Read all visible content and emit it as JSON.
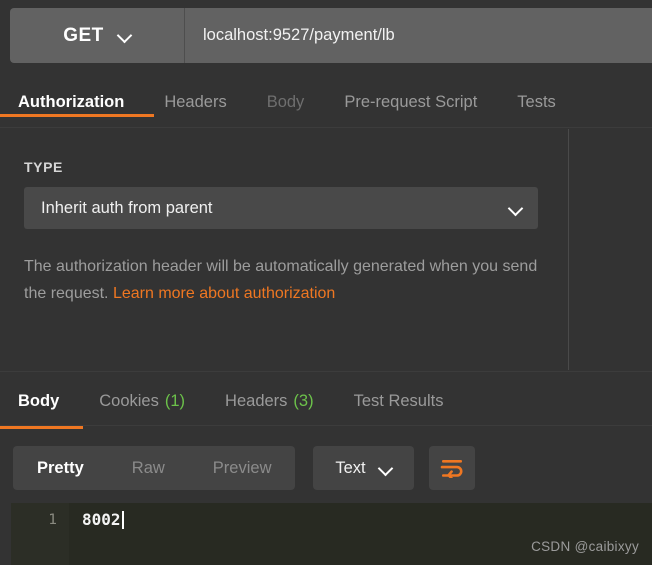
{
  "request_bar": {
    "method": "GET",
    "method_icon": "chevron-down-icon",
    "url_value": "localhost:9527/payment/lb",
    "url_placeholder": "Enter request URL"
  },
  "request_tabs": [
    {
      "label": "Authorization",
      "state": "active"
    },
    {
      "label": "Headers",
      "state": "inactive"
    },
    {
      "label": "Body",
      "state": "disabled"
    },
    {
      "label": "Pre-request Script",
      "state": "inactive"
    },
    {
      "label": "Tests",
      "state": "inactive"
    }
  ],
  "authorization": {
    "type_label": "TYPE",
    "selected_type": "Inherit auth from parent",
    "select_icon": "chevron-down-icon",
    "description_part1": "The authorization header will be automatically generated when you send the request. ",
    "description_link": "Learn more about authorization"
  },
  "response_tabs": [
    {
      "label": "Body",
      "count": "",
      "state": "active"
    },
    {
      "label": "Cookies",
      "count": "(1)",
      "state": "inactive"
    },
    {
      "label": "Headers",
      "count": "(3)",
      "state": "inactive"
    },
    {
      "label": "Test Results",
      "count": "",
      "state": "inactive"
    }
  ],
  "format_toolbar": {
    "segments": [
      {
        "label": "Pretty",
        "state": "active"
      },
      {
        "label": "Raw",
        "state": "inactive"
      },
      {
        "label": "Preview",
        "state": "inactive"
      }
    ],
    "language": "Text",
    "language_icon": "chevron-down-icon",
    "wrap_icon": "word-wrap-icon"
  },
  "editor": {
    "line_numbers": [
      "1"
    ],
    "lines": [
      "8002"
    ]
  },
  "watermark": "CSDN @caibixyy",
  "colors": {
    "accent": "#ef7722",
    "background": "#333333",
    "url_bar": "#626262",
    "control": "#444444",
    "editor_background": "#282a22",
    "count_green": "#6cc24a"
  }
}
